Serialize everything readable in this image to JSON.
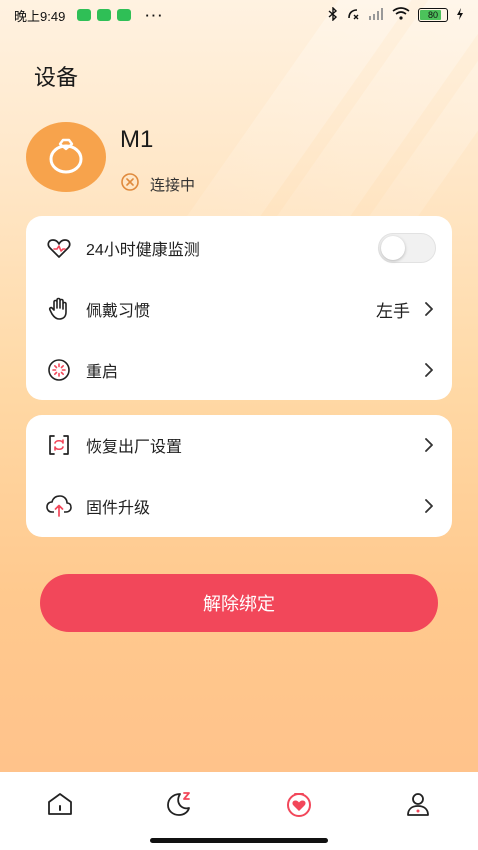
{
  "status_bar": {
    "time": "晚上9:49",
    "dots": "···",
    "battery": "80"
  },
  "page": {
    "title": "设备"
  },
  "device": {
    "name": "M1",
    "status": "连接中"
  },
  "settings_card": {
    "health_monitor_label": "24小时健康监测",
    "health_monitor_enabled": false,
    "wearing_habit_label": "佩戴习惯",
    "wearing_habit_value": "左手",
    "restart_label": "重启"
  },
  "system_card": {
    "factory_reset_label": "恢复出厂设置",
    "firmware_upgrade_label": "固件升级"
  },
  "unbind_button": {
    "label": "解除绑定"
  },
  "colors": {
    "accent": "#f2475a",
    "avatar": "#f7a34c",
    "tab_active": "#f2475a"
  },
  "tabbar": {
    "tabs": [
      "home-icon",
      "sleep-icon",
      "heart-ring-icon",
      "profile-icon"
    ],
    "active": "heart-ring-icon"
  }
}
